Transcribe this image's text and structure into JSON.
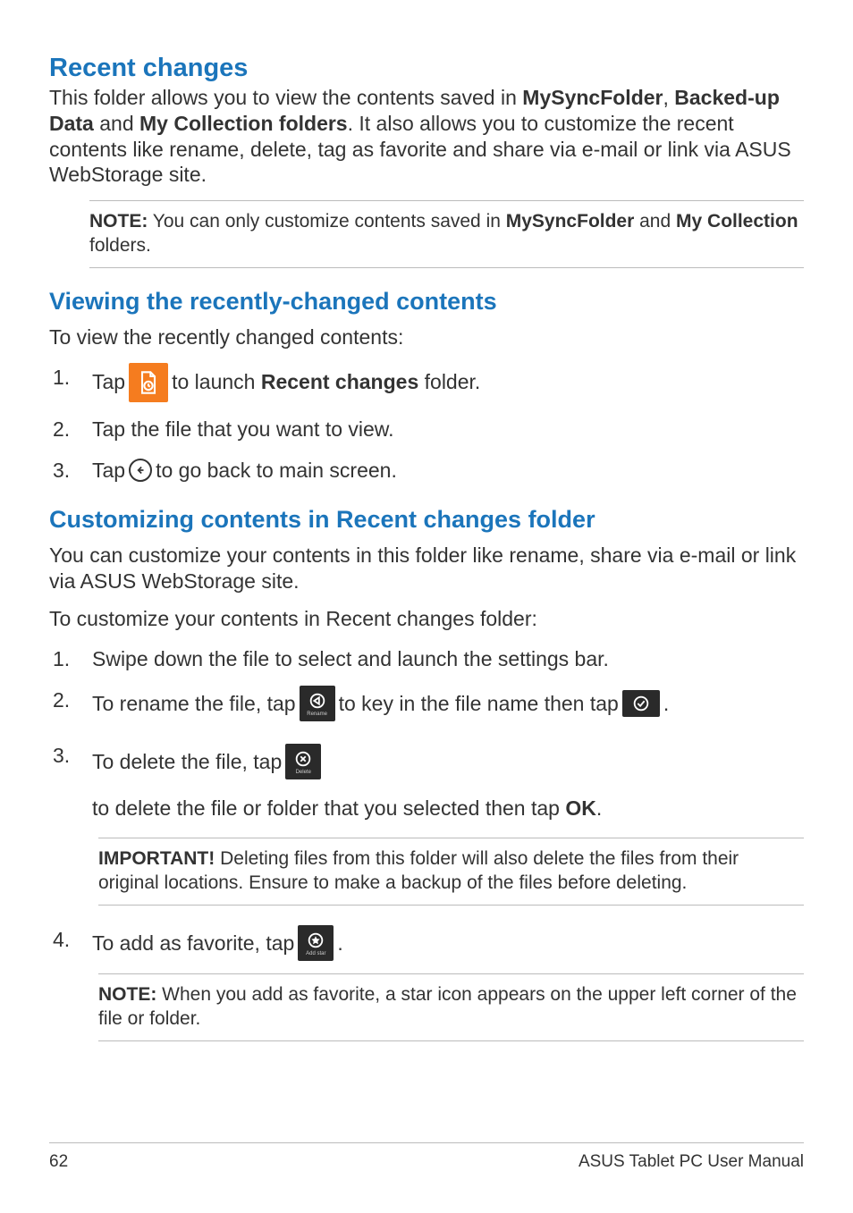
{
  "headings": {
    "recentChanges": "Recent changes",
    "viewing": "Viewing the recently-changed contents",
    "customizing": "Customizing contents in Recent changes folder"
  },
  "intro": {
    "pre": "This folder allows you to view the contents saved in ",
    "f1": "MySyncFolder",
    "sep1": ", ",
    "f2": "Backed-up Data",
    "mid": " and ",
    "f3": "My Collection folders",
    "post": ". It also allows you to customize the recent contents like rename, delete, tag as favorite and share via e-mail or link via ASUS WebStorage site."
  },
  "note1": {
    "label": "NOTE:",
    "pre": "  You can only customize contents saved in ",
    "f1": "MySyncFolder",
    "mid": " and ",
    "f2": "My Collection",
    "post": " folders."
  },
  "viewLead": "To view the recently changed contents:",
  "steps": {
    "n1": "1.",
    "n2": "2.",
    "n3": "3.",
    "n4": "4."
  },
  "view": {
    "s1_tap": "Tap",
    "s1_post_a": " to launch ",
    "s1_bold": "Recent changes",
    "s1_post_b": " folder.",
    "s2": "Tap the file that you want to view.",
    "s3_tap": "Tap",
    "s3_post": " to go back to main screen."
  },
  "custLead1": "You can customize your contents in this folder like rename, share via e-mail or link via ASUS WebStorage site.",
  "custLead2": "To customize your contents in Recent changes folder:",
  "cust": {
    "s1": "Swipe down the file to select and launch the settings bar.",
    "s2_a": "To rename the file, tap",
    "s2_b": " to key in the file name then tap",
    "s2_c": ".",
    "s3_a": "To delete the file, tap",
    "s3_b": " to delete the file or folder that you selected then tap ",
    "s3_ok": "OK",
    "s3_c": ".",
    "s4_a": "To add as favorite, tap",
    "s4_b": "."
  },
  "iconLabels": {
    "rename": "Rename",
    "delete": "Delete",
    "addstar": "Add star"
  },
  "important": {
    "label": "IMPORTANT!",
    "text": "  Deleting files from this folder will also delete the files from their original locations. Ensure to make a backup of the files before deleting."
  },
  "note2": {
    "label": "NOTE:",
    "text": "  When you add as favorite, a star icon appears on the upper left corner of the file or folder."
  },
  "footer": {
    "page": "62",
    "title": "ASUS Tablet PC User Manual"
  }
}
